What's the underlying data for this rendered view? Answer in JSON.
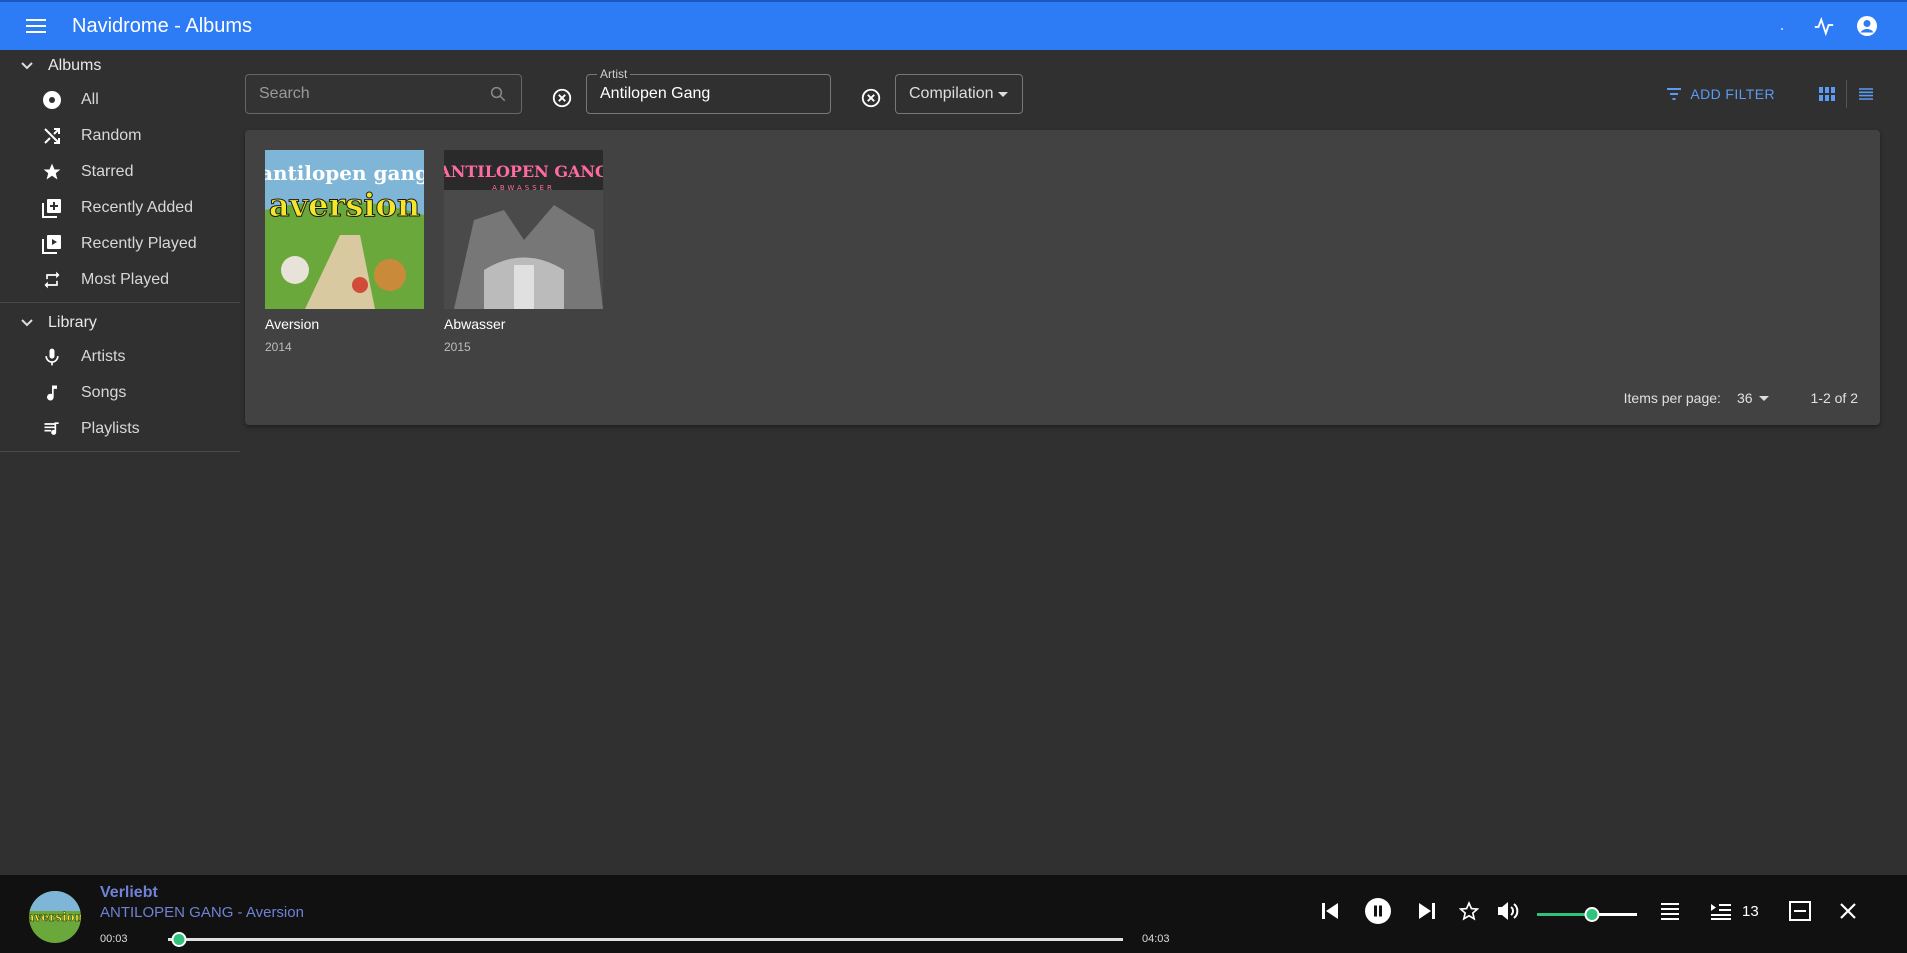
{
  "appbar": {
    "title": "Navidrome - Albums"
  },
  "sidebar": {
    "albums_header": "Albums",
    "albums_items": [
      {
        "label": "All",
        "icon": "disc-icon"
      },
      {
        "label": "Random",
        "icon": "shuffle-icon"
      },
      {
        "label": "Starred",
        "icon": "star-icon"
      },
      {
        "label": "Recently Added",
        "icon": "library-add-icon"
      },
      {
        "label": "Recently Played",
        "icon": "video-library-icon"
      },
      {
        "label": "Most Played",
        "icon": "repeat-icon"
      }
    ],
    "library_header": "Library",
    "library_items": [
      {
        "label": "Artists",
        "icon": "mic-icon"
      },
      {
        "label": "Songs",
        "icon": "music-note-icon"
      },
      {
        "label": "Playlists",
        "icon": "queue-music-icon"
      }
    ]
  },
  "filters": {
    "search_placeholder": "Search",
    "artist_label": "Artist",
    "artist_value": "Antilopen Gang",
    "compilation_label": "Compilation",
    "add_filter_label": "ADD FILTER"
  },
  "albums": [
    {
      "name": "Aversion",
      "year": "2014",
      "cover_text": "antilopen gang",
      "cover_title": "aversion"
    },
    {
      "name": "Abwasser",
      "year": "2015",
      "cover_text": "ANTILOPEN GANG",
      "cover_title": "ABWASSER"
    }
  ],
  "pagination": {
    "items_per_page_label": "Items per page:",
    "items_per_page": "36",
    "range": "1-2 of 2"
  },
  "player": {
    "song_title": "Verliebt",
    "artist_album": "ANTILOPEN GANG - Aversion",
    "current_time": "00:03",
    "total_time": "04:03",
    "progress": 0.012,
    "volume": 0.55,
    "queue_count": "13",
    "accent_color": "#31c27c"
  },
  "colors": {
    "appbar": "#2d7cf6",
    "background": "#303030",
    "panel": "#424242",
    "link": "#5c9bf3",
    "player_text": "#6f82d4"
  }
}
